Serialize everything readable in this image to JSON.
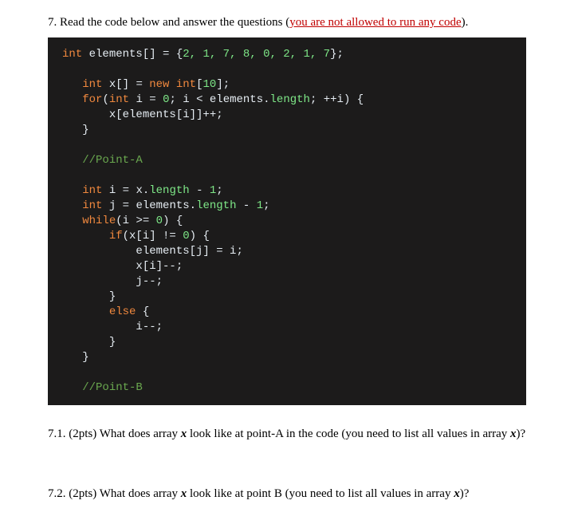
{
  "intro": {
    "prefix": "7. Read the code below and answer the questions (",
    "nocode": "you are not allowed to run any code",
    "suffix": ")."
  },
  "code": {
    "l1_a": "int",
    "l1_b": " elements[] = {",
    "l1_nums": "2, 1, 7, 8, 0, 2, 1, 7",
    "l1_c": "};",
    "l2_a": "int",
    "l2_b": " x[] = ",
    "l2_c": "new",
    "l2_d": " ",
    "l2_e": "int",
    "l2_f": "[",
    "l2_g": "10",
    "l2_h": "];",
    "l3_a": "for",
    "l3_b": "(",
    "l3_c": "int",
    "l3_d": " i = ",
    "l3_e": "0",
    "l3_f": "; i < elements.",
    "l3_g": "length",
    "l3_h": "; ++i) {",
    "l4": "x[elements[i]]++;",
    "l5": "}",
    "l6": "//Point-A",
    "l7_a": "int",
    "l7_b": " i = x.",
    "l7_c": "length",
    "l7_d": " - ",
    "l7_e": "1",
    "l7_f": ";",
    "l8_a": "int",
    "l8_b": " j = elements.",
    "l8_c": "length",
    "l8_d": " - ",
    "l8_e": "1",
    "l8_f": ";",
    "l9_a": "while",
    "l9_b": "(i >= ",
    "l9_c": "0",
    "l9_d": ") {",
    "l10_a": "if",
    "l10_b": "(x[i] != ",
    "l10_c": "0",
    "l10_d": ") {",
    "l11": "elements[j] = i;",
    "l12": "x[i]--;",
    "l13": "j--;",
    "l14": "}",
    "l15_a": "else",
    "l15_b": " {",
    "l16": "i--;",
    "l17": "}",
    "l18": "}",
    "l19": "//Point-B"
  },
  "q71": {
    "prefix": "7.1. (2pts) What does array ",
    "var": "x",
    "suffix": " look like at point-A in the code (you need to list all values in array ",
    "var2": "x",
    "end": ")?"
  },
  "q72": {
    "prefix": "7.2. (2pts) What does array ",
    "var": "x",
    "suffix": " look like at point B (you need to list all values in array ",
    "var2": "x",
    "end": ")?"
  }
}
